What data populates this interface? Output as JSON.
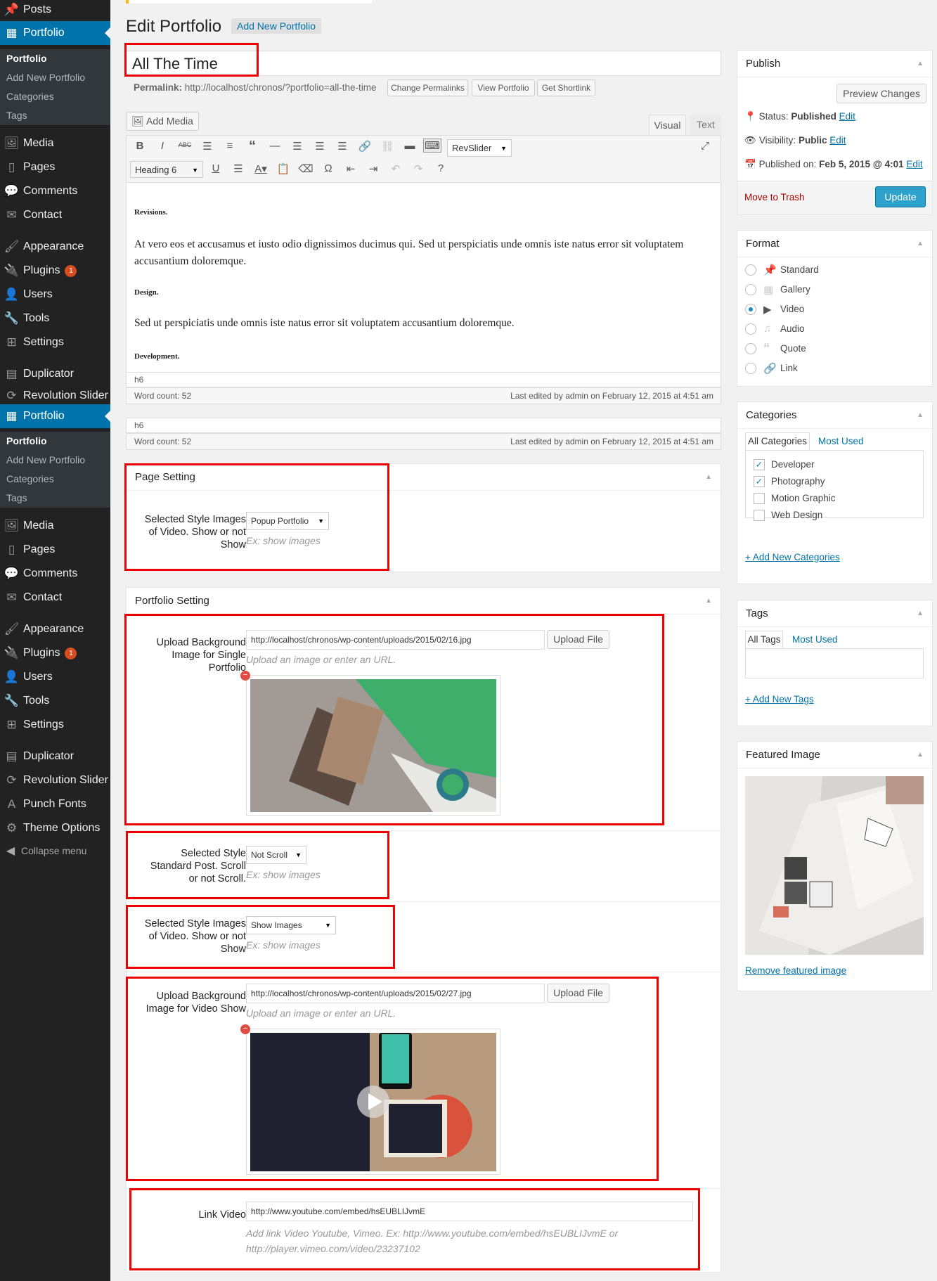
{
  "sidebar": {
    "top": [
      {
        "icon": "📌",
        "label": "Posts"
      },
      {
        "icon": "▦",
        "label": "Portfolio"
      }
    ],
    "submenu1": [
      "Portfolio",
      "Add New Portfolio",
      "Categories",
      "Tags"
    ],
    "group1": [
      {
        "icon": "🖼",
        "label": "Media"
      },
      {
        "icon": "▯",
        "label": "Pages"
      },
      {
        "icon": "💬",
        "label": "Comments"
      },
      {
        "icon": "✉",
        "label": "Contact"
      }
    ],
    "group2": [
      {
        "icon": "🖌",
        "label": "Appearance"
      },
      {
        "icon": "🔌",
        "label": "Plugins",
        "badge": "1"
      },
      {
        "icon": "👤",
        "label": "Users"
      },
      {
        "icon": "🔧",
        "label": "Tools"
      },
      {
        "icon": "⊞",
        "label": "Settings"
      }
    ],
    "group3": [
      {
        "icon": "▤",
        "label": "Duplicator"
      },
      {
        "icon": "⟳",
        "label": "Revolution Slider"
      }
    ],
    "portfolio2": {
      "icon": "▦",
      "label": "Portfolio"
    },
    "submenu2": [
      "Portfolio",
      "Add New Portfolio",
      "Categories",
      "Tags"
    ],
    "group4": [
      {
        "icon": "🖼",
        "label": "Media"
      },
      {
        "icon": "▯",
        "label": "Pages"
      },
      {
        "icon": "💬",
        "label": "Comments"
      },
      {
        "icon": "✉",
        "label": "Contact"
      }
    ],
    "group5": [
      {
        "icon": "🖌",
        "label": "Appearance"
      },
      {
        "icon": "🔌",
        "label": "Plugins",
        "badge": "1"
      },
      {
        "icon": "👤",
        "label": "Users"
      },
      {
        "icon": "🔧",
        "label": "Tools"
      },
      {
        "icon": "⊞",
        "label": "Settings"
      }
    ],
    "group6": [
      {
        "icon": "▤",
        "label": "Duplicator"
      },
      {
        "icon": "⟳",
        "label": "Revolution Slider"
      },
      {
        "icon": "A",
        "label": "Punch Fonts"
      },
      {
        "icon": "⚙",
        "label": "Theme Options"
      }
    ],
    "collapse": "Collapse menu"
  },
  "header": {
    "title": "Edit Portfolio",
    "add_new": "Add New Portfolio"
  },
  "post": {
    "title": "All The Time",
    "permalink_label": "Permalink:",
    "permalink_url": "http://localhost/chronos/?portfolio=all-the-time",
    "change_permalinks": "Change Permalinks",
    "view_portfolio": "View Portfolio",
    "get_shortlink": "Get Shortlink"
  },
  "editor": {
    "add_media": "Add Media",
    "tab_visual": "Visual",
    "tab_text": "Text",
    "revslider": "RevSlider",
    "format_select": "Heading 6",
    "content": {
      "h1": "Revisions.",
      "p1": "At vero eos et accusamus et iusto odio dignissimos ducimus qui. Sed ut perspiciatis unde omnis iste natus error sit voluptatem accusantium doloremque.",
      "h2": "Design.",
      "p2": "Sed ut perspiciatis unde omnis iste natus error sit voluptatem accusantium doloremque.",
      "h3": "Development."
    },
    "path": "h6",
    "word_count": "Word count: 52",
    "last_edited": "Last edited by admin on February 12, 2015 at 4:51 am"
  },
  "page_setting": {
    "title": "Page Setting",
    "label": "Selected Style Images of Video. Show or not Show",
    "value": "Popup Portfolio",
    "help": "Ex: show images"
  },
  "portfolio_setting": {
    "title": "Portfolio Setting",
    "bg_single_label": "Upload Background Image for Single Portfolio",
    "bg_single_url": "http://localhost/chronos/wp-content/uploads/2015/02/16.jpg",
    "upload_file": "Upload File",
    "upload_help": "Upload an image or enter an URL.",
    "scroll_label": "Selected Style Standard Post. Scroll or not Scroll.",
    "scroll_value": "Not Scroll",
    "scroll_help": "Ex: show images",
    "images_label": "Selected Style Images of Video. Show or not Show",
    "images_value": "Show Images",
    "images_help": "Ex: show images",
    "bg_video_label": "Upload Background Image for Video Show",
    "bg_video_url": "http://localhost/chronos/wp-content/uploads/2015/02/27.jpg",
    "upload_file2": "Upload File",
    "upload_help2": "Upload an image or enter an URL.",
    "link_video_label": "Link Video",
    "link_video_value": "http://www.youtube.com/embed/hsEUBLIJvmE",
    "link_video_help": "Add link Video Youtube, Vimeo. Ex: http://www.youtube.com/embed/hsEUBLIJvmE or http://player.vimeo.com/video/23237102"
  },
  "publish": {
    "title": "Publish",
    "preview": "Preview Changes",
    "status_label": "Status:",
    "status_value": "Published",
    "visibility_label": "Visibility:",
    "visibility_value": "Public",
    "published_label": "Published on:",
    "published_value": "Feb 5, 2015 @ 4:01",
    "edit": "Edit",
    "trash": "Move to Trash",
    "update": "Update"
  },
  "format": {
    "title": "Format",
    "options": [
      "Standard",
      "Gallery",
      "Video",
      "Audio",
      "Quote",
      "Link"
    ],
    "selected": "Video"
  },
  "categories": {
    "title": "Categories",
    "tab_all": "All Categories",
    "tab_used": "Most Used",
    "items": [
      {
        "label": "Developer",
        "checked": true
      },
      {
        "label": "Photography",
        "checked": true
      },
      {
        "label": "Motion Graphic",
        "checked": false
      },
      {
        "label": "Web Design",
        "checked": false
      }
    ],
    "add_new": "+ Add New Categories"
  },
  "tags": {
    "title": "Tags",
    "tab_all": "All Tags",
    "tab_used": "Most Used",
    "add_new": "+ Add New Tags"
  },
  "featured": {
    "title": "Featured Image",
    "remove": "Remove featured image"
  },
  "colors": {
    "accent": "#0073aa",
    "highlight": "#e00000",
    "update": "#2ea2cc"
  }
}
